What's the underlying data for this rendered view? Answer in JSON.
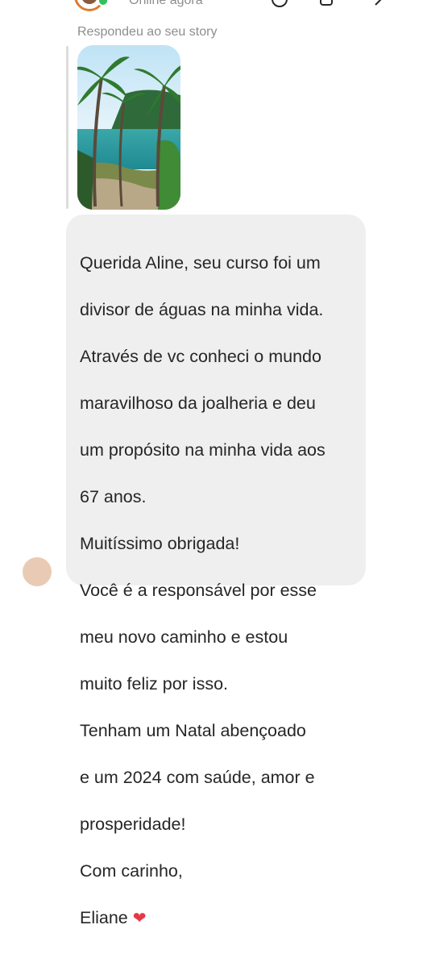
{
  "header": {
    "status": "Online agora",
    "icons": [
      "call-icon",
      "video-call-icon",
      "info-icon"
    ]
  },
  "story": {
    "label": "Respondeu ao seu story",
    "thumbnail": "palm-trees-beach-photo"
  },
  "message": {
    "lines": [
      "Querida Aline, seu curso foi um",
      "divisor de águas na minha vida.",
      "Através de vc conheci o mundo",
      "maravilhoso da joalheria e deu",
      "um propósito na minha vida aos",
      "67 anos.",
      "Muitíssimo obrigada!",
      "Você é a responsável por esse",
      "meu novo caminho e estou",
      "muito feliz por isso.",
      "Tenham um Natal abençoado",
      "e um 2024 com saúde, amor e",
      "prosperidade!",
      "Com carinho,"
    ],
    "signature": "Eliane",
    "signature_emoji": "❤"
  },
  "colors": {
    "bubble": "#efefef",
    "online": "#2fc25b",
    "secondary_text": "#8e8e8e"
  }
}
